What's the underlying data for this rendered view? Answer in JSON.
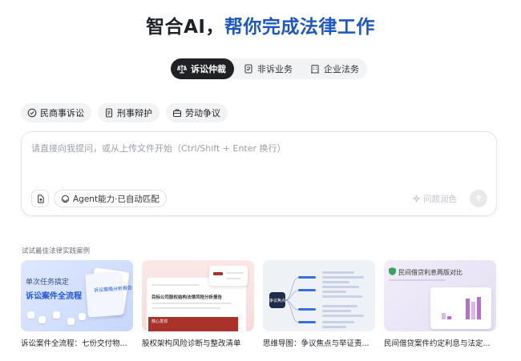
{
  "headline": {
    "part1": "智合AI，",
    "part2": "帮你完成法律工作"
  },
  "segments": [
    {
      "label": "诉讼仲裁",
      "active": true,
      "icon": "scales-icon"
    },
    {
      "label": "非诉业务",
      "active": false,
      "icon": "document-check-icon"
    },
    {
      "label": "企业法务",
      "active": false,
      "icon": "building-icon"
    }
  ],
  "chips": [
    {
      "label": "民商事诉讼",
      "icon": "badge-check-icon"
    },
    {
      "label": "刑事辩护",
      "icon": "document-icon"
    },
    {
      "label": "劳动争议",
      "icon": "briefcase-icon"
    }
  ],
  "composer": {
    "placeholder": "请直接向我提问，或从上传文件开始（Ctrl/Shift + Enter 换行）",
    "agent_label": "Agent能力·已自动匹配",
    "polish_label": "问题润色"
  },
  "cases": {
    "section_title": "试试最佳法律实践案例",
    "items": [
      {
        "title": "诉讼案件全流程：七份交付物...",
        "thumb_line1": "单次任务搞定",
        "thumb_line2": "诉讼案件全流程",
        "thumb_doc": "诉讼策略分析报告"
      },
      {
        "title": "股权架构风险诊断与整改清单",
        "thumb_heading": "目标公司股权结构法律风险分析报告",
        "thumb_badge": "核心发现"
      },
      {
        "title": "思维导图：争议焦点与举证责...",
        "thumb_node": "争议焦点"
      },
      {
        "title": "民间借贷案件约定利息与法定...",
        "thumb_heading": "民间借贷利息两版对比"
      }
    ]
  },
  "colors": {
    "accent_blue": "#1b57c2",
    "active_segment": "#202124",
    "chip_bg": "#f2f3f5"
  }
}
